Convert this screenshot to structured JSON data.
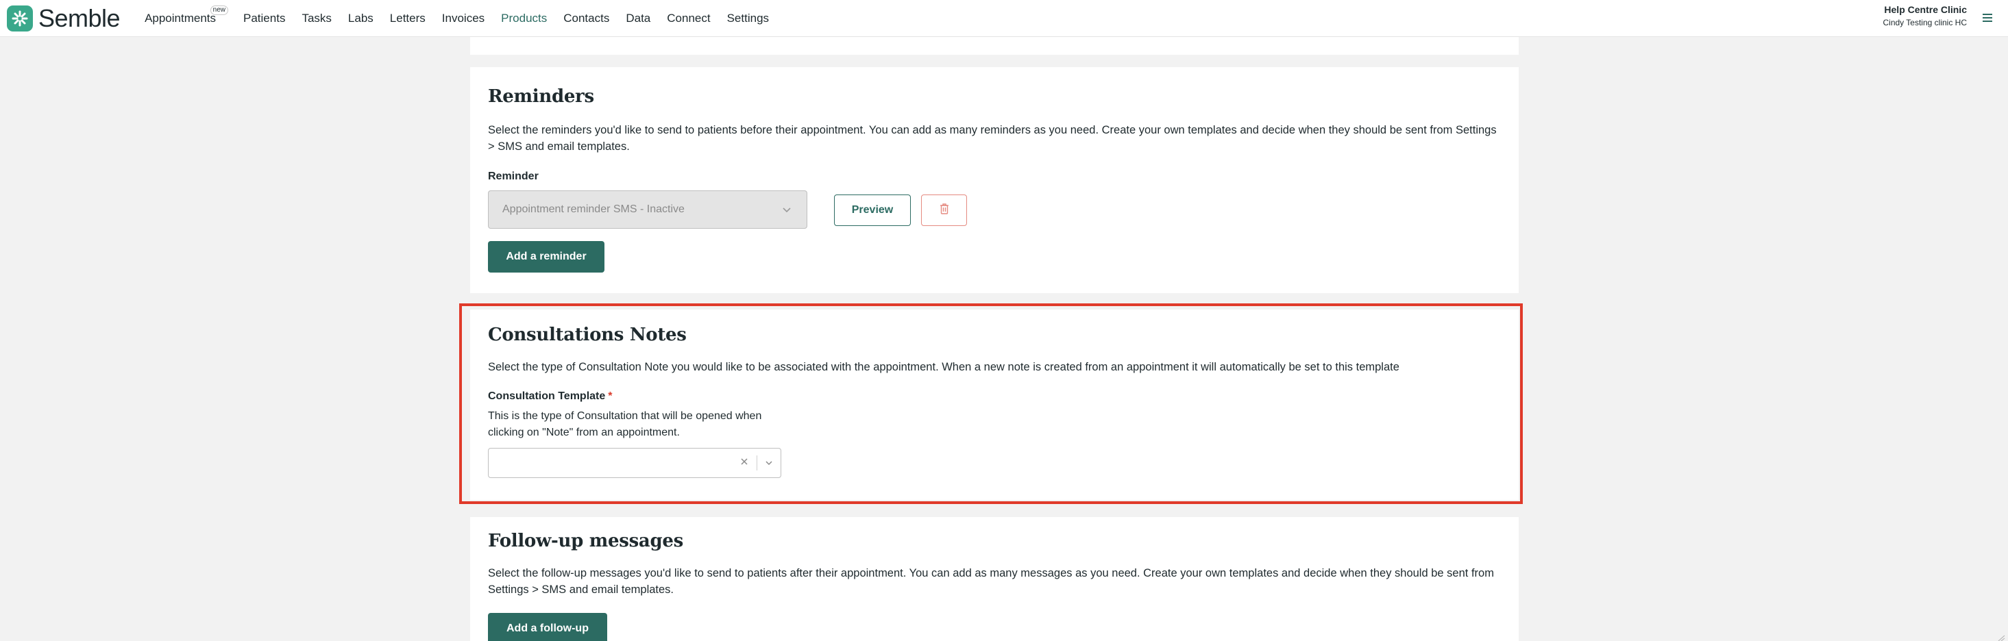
{
  "app": {
    "brand": "Semble"
  },
  "nav": {
    "items": [
      {
        "label": "Appointments",
        "badge": "new"
      },
      {
        "label": "Patients"
      },
      {
        "label": "Tasks"
      },
      {
        "label": "Labs"
      },
      {
        "label": "Letters"
      },
      {
        "label": "Invoices"
      },
      {
        "label": "Products",
        "active": true
      },
      {
        "label": "Contacts"
      },
      {
        "label": "Data"
      },
      {
        "label": "Connect"
      },
      {
        "label": "Settings"
      }
    ]
  },
  "account": {
    "clinic": "Help Centre Clinic",
    "user": "Cindy Testing clinic HC"
  },
  "reminders": {
    "title": "Reminders",
    "description": "Select the reminders you'd like to send to patients before their appointment. You can add as many reminders as you need. Create your own templates and decide when they should be sent from Settings > SMS and email templates.",
    "field_label": "Reminder",
    "selected_value": "Appointment reminder SMS - Inactive",
    "preview_label": "Preview",
    "add_label": "Add a reminder"
  },
  "consultations": {
    "title": "Consultations Notes",
    "description": "Select the type of Consultation Note you would like to be associated with the appointment. When a new note is created from an appointment it will automatically be set to this template",
    "field_label": "Consultation Template",
    "required_mark": "*",
    "help_text": "This is the type of Consultation that will be opened when clicking on \"Note\" from an appointment.",
    "selected_value": ""
  },
  "followup": {
    "title": "Follow-up messages",
    "description": "Select the follow-up messages you'd like to send to patients after their appointment. You can add as many messages as you need. Create your own templates and decide when they should be sent from Settings > SMS and email templates.",
    "add_label": "Add a follow-up"
  },
  "colors": {
    "brand": "#3aa88b",
    "primary": "#2c6b62",
    "highlight": "#e03a2a",
    "danger_border": "#e58a80"
  },
  "icons": [
    "semble-logo-icon",
    "hamburger-menu-icon",
    "chevron-down-icon",
    "trash-icon",
    "clear-icon"
  ]
}
